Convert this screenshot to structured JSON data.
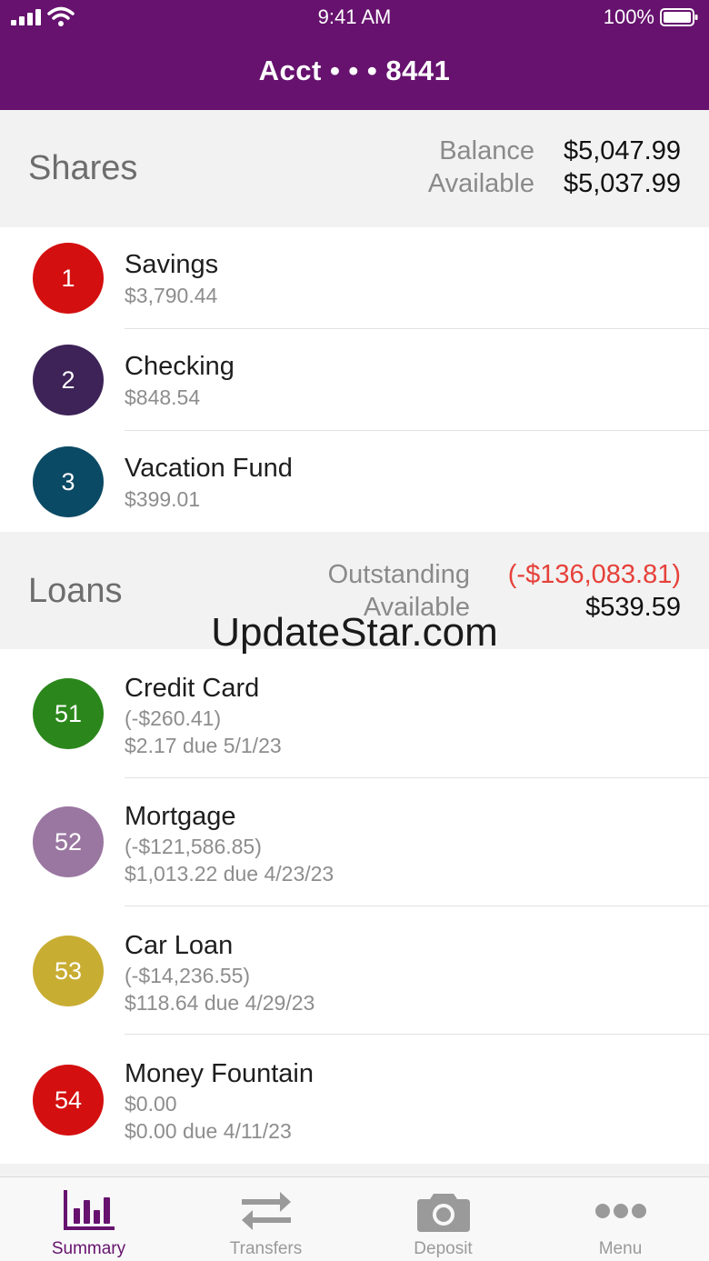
{
  "status_bar": {
    "time": "9:41 AM",
    "battery": "100%"
  },
  "nav": {
    "title": "Acct • • • 8441"
  },
  "shares": {
    "title": "Shares",
    "balance_label": "Balance",
    "balance_value": "$5,047.99",
    "available_label": "Available",
    "available_value": "$5,037.99",
    "items": [
      {
        "number": "1",
        "name": "Savings",
        "amount": "$3,790.44",
        "color": "#d40f0f"
      },
      {
        "number": "2",
        "name": "Checking",
        "amount": "$848.54",
        "color": "#3d2357"
      },
      {
        "number": "3",
        "name": "Vacation Fund",
        "amount": "$399.01",
        "color": "#0b4a64"
      }
    ]
  },
  "loans": {
    "title": "Loans",
    "outstanding_label": "Outstanding",
    "outstanding_value": "(-$136,083.81)",
    "available_label": "Available",
    "available_value": "$539.59",
    "items": [
      {
        "number": "51",
        "name": "Credit Card",
        "amount": "(-$260.41)",
        "due": "$2.17 due 5/1/23",
        "color": "#2b871b"
      },
      {
        "number": "52",
        "name": "Mortgage",
        "amount": "(-$121,586.85)",
        "due": "$1,013.22 due 4/23/23",
        "color": "#9a77a1"
      },
      {
        "number": "53",
        "name": "Car Loan",
        "amount": "(-$14,236.55)",
        "due": "$118.64 due 4/29/23",
        "color": "#c8ad33"
      },
      {
        "number": "54",
        "name": "Money Fountain",
        "amount": "$0.00",
        "due": "$0.00 due 4/11/23",
        "color": "#d40f0f"
      }
    ]
  },
  "watermark": "UpdateStar.com",
  "tabs": [
    {
      "label": "Summary",
      "icon": "bar-chart-icon"
    },
    {
      "label": "Transfers",
      "icon": "transfer-arrows-icon"
    },
    {
      "label": "Deposit",
      "icon": "camera-icon"
    },
    {
      "label": "Menu",
      "icon": "more-dots-icon"
    }
  ],
  "colors": {
    "brand": "#66126e",
    "negative": "#e6413a",
    "tab_inactive": "#9a9a9a"
  }
}
